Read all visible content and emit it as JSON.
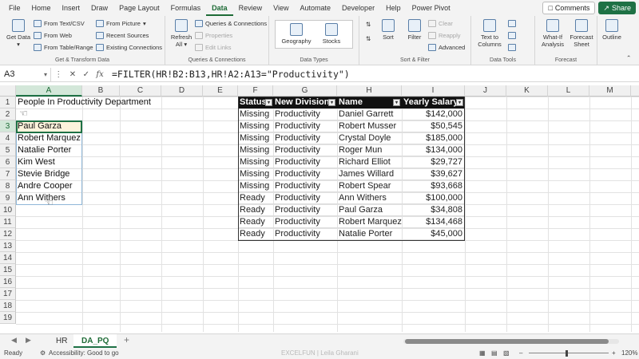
{
  "menu": {
    "tabs": [
      "File",
      "Home",
      "Insert",
      "Draw",
      "Page Layout",
      "Formulas",
      "Data",
      "Review",
      "View",
      "Automate",
      "Developer",
      "Help",
      "Power Pivot"
    ],
    "active": "Data",
    "comments_label": "Comments",
    "share_label": "Share"
  },
  "ribbon": {
    "get_transform": {
      "get_data": "Get Data",
      "from_text_csv": "From Text/CSV",
      "from_web": "From Web",
      "from_table_range": "From Table/Range",
      "from_picture": "From Picture",
      "recent_sources": "Recent Sources",
      "existing_connections": "Existing Connections",
      "label": "Get & Transform Data"
    },
    "queries": {
      "refresh_all": "Refresh All",
      "queries_connections": "Queries & Connections",
      "properties": "Properties",
      "edit_links": "Edit Links",
      "label": "Queries & Connections"
    },
    "data_types": {
      "geography": "Geography",
      "stocks": "Stocks",
      "label": "Data Types"
    },
    "sort_filter": {
      "sort": "Sort",
      "filter": "Filter",
      "clear": "Clear",
      "reapply": "Reapply",
      "advanced": "Advanced",
      "label": "Sort & Filter"
    },
    "data_tools": {
      "text_to_columns": "Text to Columns",
      "label": "Data Tools"
    },
    "forecast": {
      "what_if": "What-If Analysis",
      "forecast_sheet": "Forecast Sheet",
      "label": "Forecast"
    },
    "outline": {
      "outline": "Outline"
    }
  },
  "formula_bar": {
    "name_box": "A3",
    "fx": "fx",
    "formula": "=FILTER(HR!B2:B13,HR!A2:A13=\"Productivity\")"
  },
  "columns": [
    "A",
    "B",
    "C",
    "D",
    "E",
    "F",
    "G",
    "H",
    "I",
    "J",
    "K",
    "L",
    "M"
  ],
  "rows": [
    "1",
    "2",
    "3",
    "4",
    "5",
    "6",
    "7",
    "8",
    "9",
    "10",
    "11",
    "12",
    "13",
    "14",
    "15",
    "16",
    "17",
    "18",
    "19"
  ],
  "sheet": {
    "a1": "People In Productivity Department",
    "a_list": [
      "Paul Garza",
      "Robert Marquez",
      "Natalie Porter",
      "Kim West",
      "Stevie Bridge",
      "Andre Cooper",
      "Ann Withers"
    ],
    "table_headers": [
      "Status",
      "New Division",
      "Name",
      "Yearly Salary"
    ],
    "table_rows": [
      [
        "Missing",
        "Productivity",
        "Daniel Garrett",
        "$142,000"
      ],
      [
        "Missing",
        "Productivity",
        "Robert Musser",
        "$50,545"
      ],
      [
        "Missing",
        "Productivity",
        "Crystal Doyle",
        "$185,000"
      ],
      [
        "Missing",
        "Productivity",
        "Roger Mun",
        "$134,000"
      ],
      [
        "Missing",
        "Productivity",
        "Richard Elliot",
        "$29,727"
      ],
      [
        "Missing",
        "Productivity",
        "James Willard",
        "$39,627"
      ],
      [
        "Missing",
        "Productivity",
        "Robert Spear",
        "$93,668"
      ],
      [
        "Ready",
        "Productivity",
        "Ann Withers",
        "$100,000"
      ],
      [
        "Ready",
        "Productivity",
        "Paul Garza",
        "$34,808"
      ],
      [
        "Ready",
        "Productivity",
        "Robert Marquez",
        "$134,468"
      ],
      [
        "Ready",
        "Productivity",
        "Natalie Porter",
        "$45,000"
      ]
    ]
  },
  "sheet_tabs": [
    "HR",
    "DA_PQ"
  ],
  "active_sheet": "DA_PQ",
  "status": {
    "ready": "Ready",
    "accessibility": "Accessibility: Good to go",
    "watermark": "EXCELFUN | Leila Gharani",
    "zoom": "120%"
  }
}
